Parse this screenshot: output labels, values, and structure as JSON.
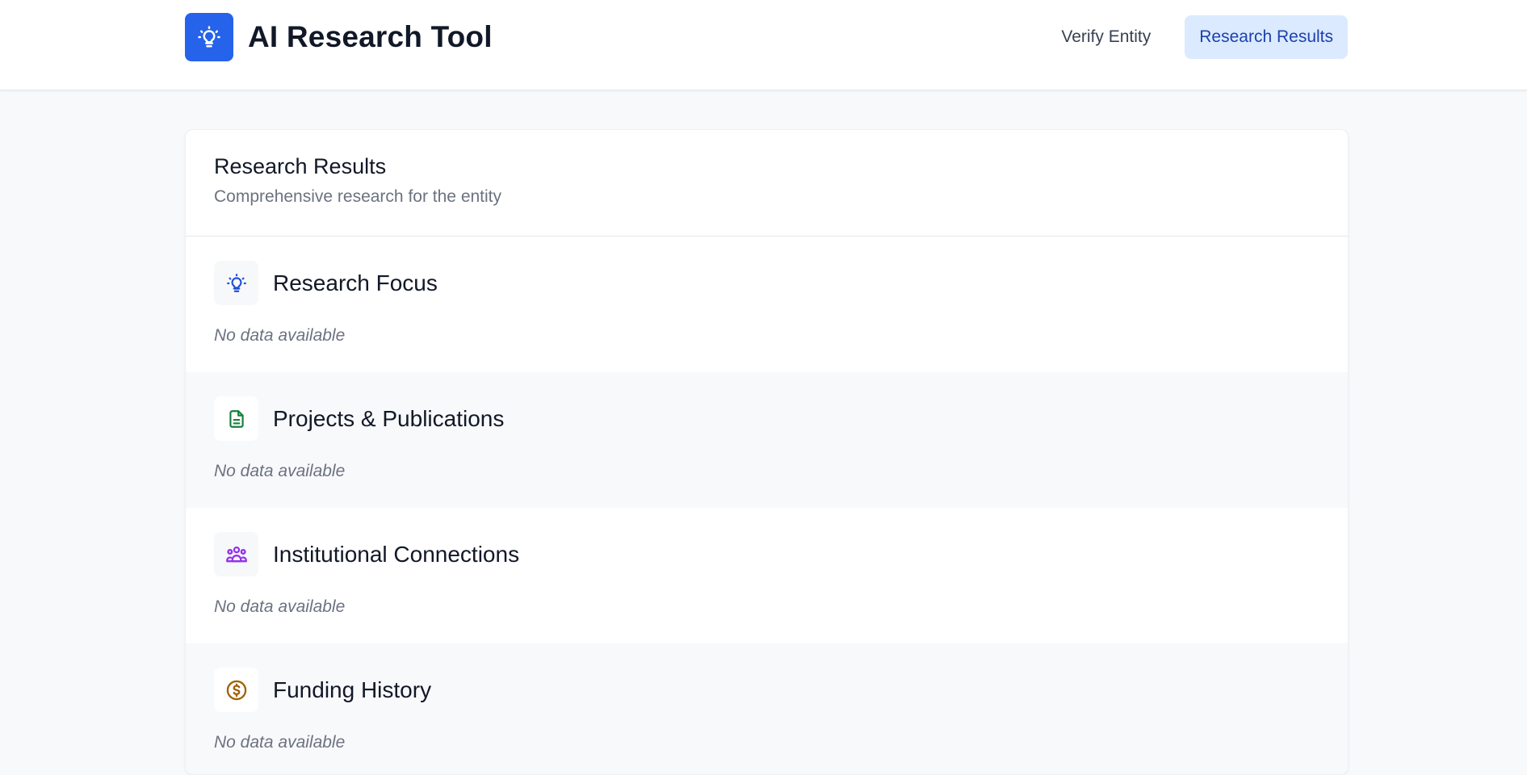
{
  "app": {
    "title": "AI Research Tool",
    "logo_icon": "lightbulb-icon",
    "brand_color": "#2563eb"
  },
  "nav": {
    "items": [
      {
        "label": "Verify Entity",
        "active": false
      },
      {
        "label": "Research Results",
        "active": true
      }
    ]
  },
  "card": {
    "title": "Research Results",
    "subtitle": "Comprehensive research for the entity"
  },
  "sections": [
    {
      "title": "Research Focus",
      "icon": "lightbulb-icon",
      "icon_color": "#1d4ed8",
      "content": "No data available"
    },
    {
      "title": "Projects & Publications",
      "icon": "document-icon",
      "icon_color": "#15803d",
      "content": "No data available"
    },
    {
      "title": "Institutional Connections",
      "icon": "users-icon",
      "icon_color": "#9333ea",
      "content": "No data available"
    },
    {
      "title": "Funding History",
      "icon": "dollar-icon",
      "icon_color": "#a16207",
      "content": "No data available"
    }
  ]
}
